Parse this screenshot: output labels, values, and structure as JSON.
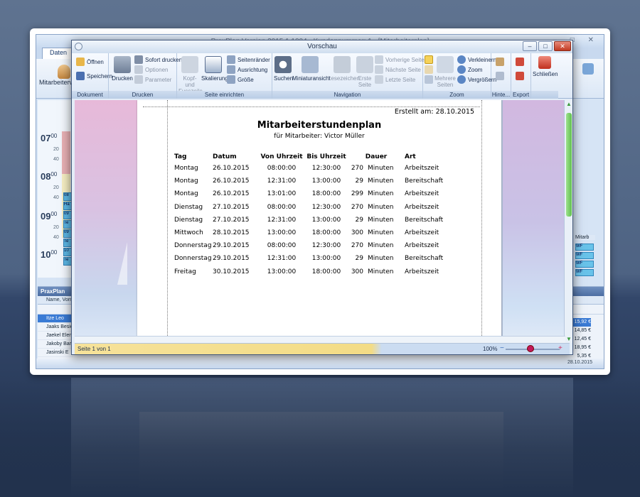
{
  "back_app": {
    "title": "PraxPlan Version 2015.1.1004 - Kundennummer: 1 - [Mitarbeiterplan]",
    "tab": "Daten",
    "ribbon_label": "Mitarbeiterverw",
    "hours": [
      {
        "h": "07",
        "m": "00"
      },
      {
        "h": "08",
        "m": "00"
      },
      {
        "h": "09",
        "m": "00"
      },
      {
        "h": "10",
        "m": "00"
      }
    ],
    "minute_marks": [
      "20",
      "40",
      "20",
      "40",
      "20",
      "40"
    ],
    "cal_entries": [
      "08",
      "Ha",
      "09",
      "Te",
      "09",
      "Te",
      "10",
      "Te"
    ],
    "panel_title": "PraxPlan",
    "panel_col_header": "Name, Vorn",
    "employees": [
      "Itze Leo",
      "Jaaks Besio",
      "Jaekel Elen",
      "Jakoby Bar",
      "Jasinski E"
    ],
    "right_header": "Mitarb",
    "right_cells": [
      "WF",
      "WF",
      "WF",
      "WF"
    ],
    "euros": [
      "15,92 €",
      "14,85 €",
      "12,45 €",
      "18,95 €",
      "5,35 €"
    ],
    "status_date": "28.10.2015"
  },
  "window": {
    "title": "Vorschau",
    "controls": {
      "minimize": "–",
      "maximize": "□",
      "close": "✕"
    }
  },
  "ribbon": {
    "groups": {
      "dokument": "Dokument",
      "drucken": "Drucken",
      "seite": "Seite einrichten",
      "navigation": "Navigation",
      "zoom": "Zoom",
      "hinter": "Hinte...",
      "export": "Export"
    },
    "oeffnen": "Öffnen",
    "speichern": "Speichern",
    "drucken": "Drucken",
    "sofort_drucken": "Sofort drucken",
    "optionen": "Optionen",
    "parameter": "Parameter",
    "kopf_line1": "Kopf- und",
    "kopf_line2": "Fusszeile",
    "skalierung": "Skalierung",
    "seitenraender": "Seitenränder",
    "ausrichtung": "Ausrichtung",
    "groesse": "Größe",
    "suchen": "Suchen",
    "miniaturansicht": "Miniaturansicht",
    "lesezeichen": "Lesezeichen",
    "erste_line1": "Erste",
    "erste_line2": "Seite",
    "vorherige": "Vorherige Seite",
    "naechste": "Nächste Seite",
    "letzte": "Letzte Seite",
    "mehrere_line1": "Mehrere",
    "mehrere_line2": "Seiten",
    "verkleinern": "Verkleinern",
    "zoom": "Zoom",
    "vergroessern": "Vergrößern",
    "schliessen": "Schließen"
  },
  "document": {
    "created": "Erstellt am: 28.10.2015",
    "title": "Mitarbeiterstundenplan",
    "subtitle": "für Mitarbeiter: Victor Müller",
    "headers": [
      "Tag",
      "Datum",
      "Von Uhrzeit",
      "Bis Uhrzeit",
      "Dauer",
      "Art"
    ],
    "rows": [
      [
        "Montag",
        "26.10.2015",
        "08:00:00",
        "12:30:00",
        "270",
        "Minuten",
        "Arbeitszeit"
      ],
      [
        "Montag",
        "26.10.2015",
        "12:31:00",
        "13:00:00",
        "29",
        "Minuten",
        "Bereitschaft"
      ],
      [
        "Montag",
        "26.10.2015",
        "13:01:00",
        "18:00:00",
        "299",
        "Minuten",
        "Arbeitszeit"
      ],
      [
        "Dienstag",
        "27.10.2015",
        "08:00:00",
        "12:30:00",
        "270",
        "Minuten",
        "Arbeitszeit"
      ],
      [
        "Dienstag",
        "27.10.2015",
        "12:31:00",
        "13:00:00",
        "29",
        "Minuten",
        "Bereitschaft"
      ],
      [
        "Mittwoch",
        "28.10.2015",
        "13:00:00",
        "18:00:00",
        "300",
        "Minuten",
        "Arbeitszeit"
      ],
      [
        "Donnerstag",
        "29.10.2015",
        "08:00:00",
        "12:30:00",
        "270",
        "Minuten",
        "Arbeitszeit"
      ],
      [
        "Donnerstag",
        "29.10.2015",
        "12:31:00",
        "13:00:00",
        "29",
        "Minuten",
        "Bereitschaft"
      ],
      [
        "Freitag",
        "30.10.2015",
        "13:00:00",
        "18:00:00",
        "300",
        "Minuten",
        "Arbeitszeit"
      ]
    ]
  },
  "statusbar": {
    "page": "Seite 1 von 1",
    "zoom": "100%",
    "zoom_minus": "−",
    "zoom_plus": "+"
  },
  "colors": {
    "accent": "#3a7bd5",
    "close": "#c13a22",
    "status_yellow": "#f3dc86"
  }
}
